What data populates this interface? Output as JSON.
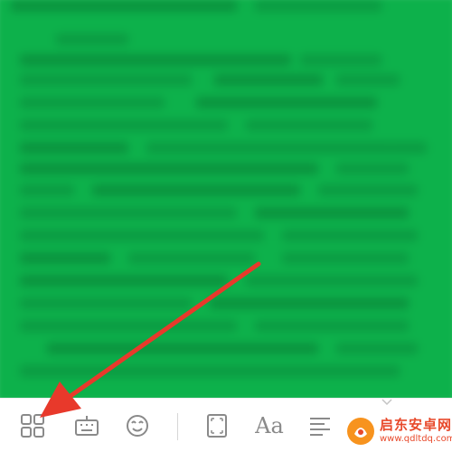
{
  "colors": {
    "content_background": "#0db14b",
    "blurred_text": "#0a7a35",
    "toolbar_background": "#ffffff",
    "toolbar_icon": "#8a8a8a",
    "arrow": "#e8392b",
    "watermark": "#e8492b"
  },
  "toolbar": {
    "items": [
      {
        "name": "grid-apps-icon"
      },
      {
        "name": "keyboard-icon"
      },
      {
        "name": "emoji-face-icon"
      },
      {
        "name": "page-frame-icon"
      },
      {
        "name": "font-style-icon",
        "label": "Aa"
      },
      {
        "name": "paragraph-align-icon"
      }
    ],
    "collapse_icon": "chevron-down-icon"
  },
  "annotation": {
    "type": "arrow",
    "points_to": "grid-apps-icon"
  },
  "watermark": {
    "title": "启东安卓网",
    "url": "www.qdltdq.com"
  }
}
